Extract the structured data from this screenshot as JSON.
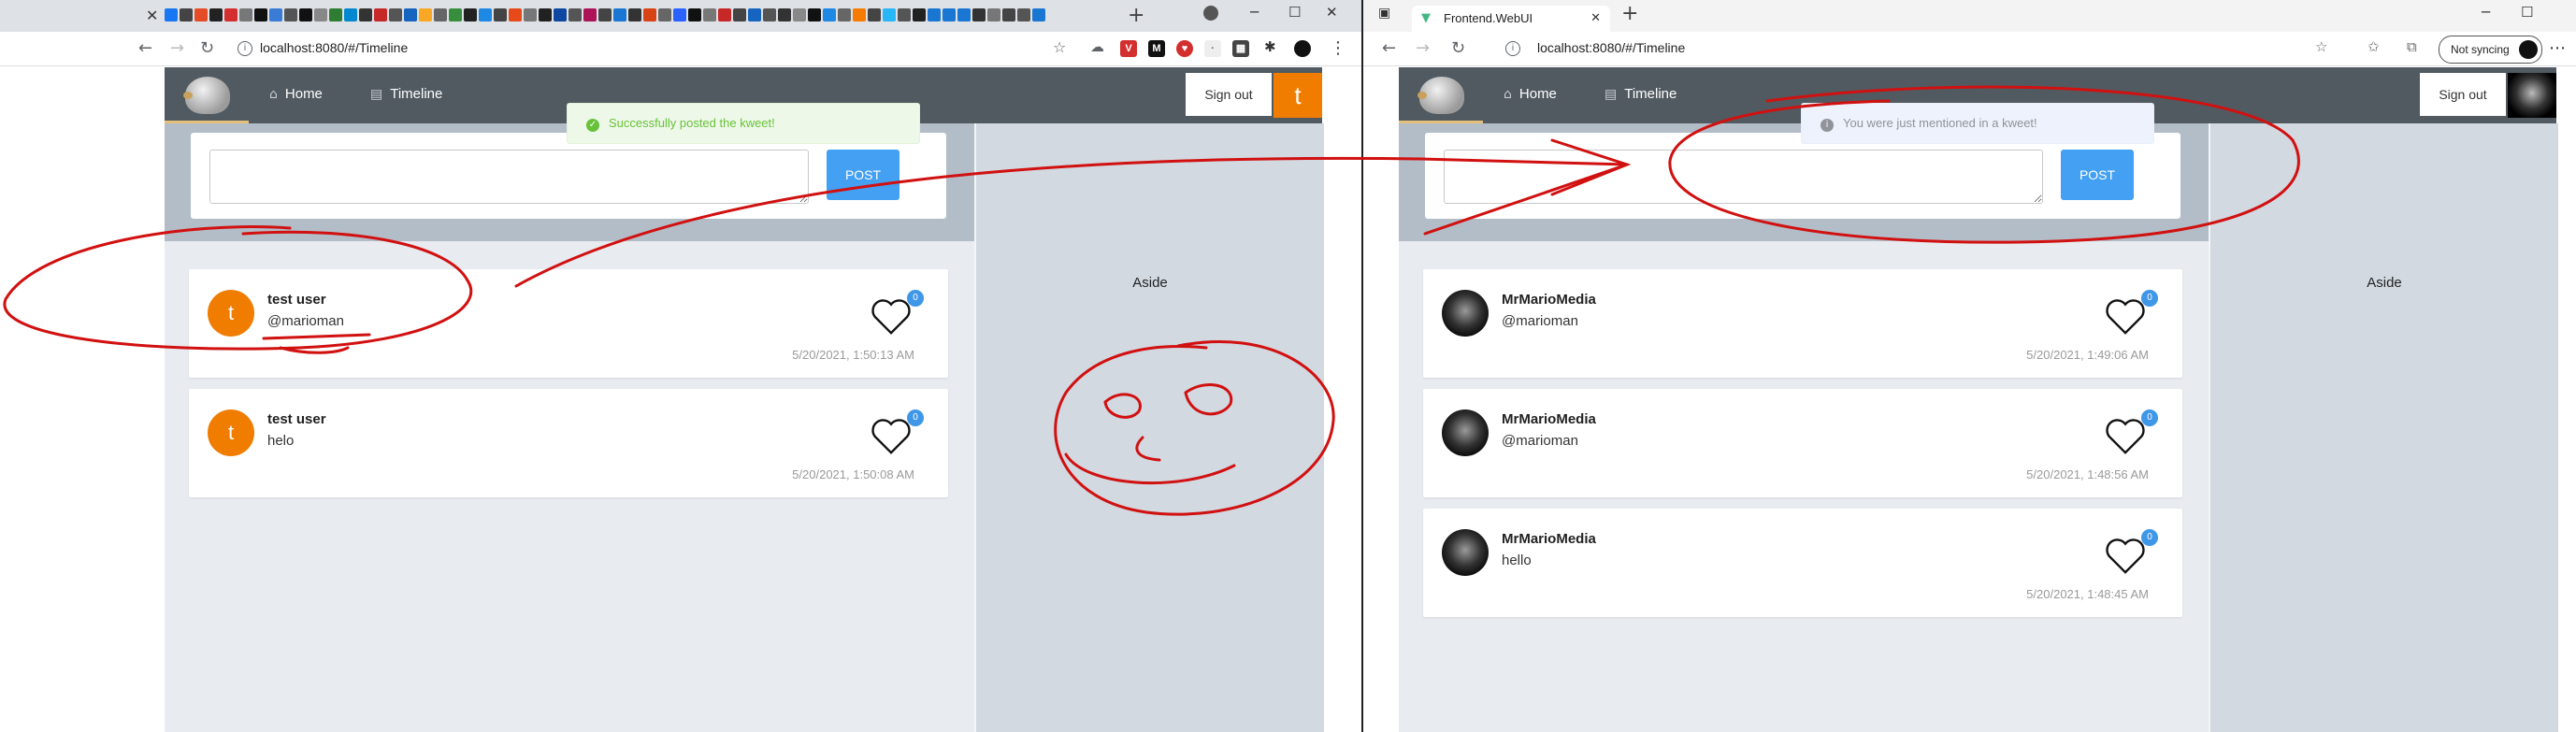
{
  "left": {
    "url": "localhost:8080/#/Timeline",
    "nav": {
      "home": "Home",
      "timeline": "Timeline",
      "signout": "Sign out",
      "avatar_letter": "t"
    },
    "composer": {
      "post": "POST"
    },
    "toast": "Successfully posted the kweet!",
    "aside": "Aside",
    "kweets": [
      {
        "name": "test user",
        "text": "@marioman",
        "likes": "0",
        "date": "5/20/2021, 1:50:13 AM",
        "avatar_letter": "t"
      },
      {
        "name": "test user",
        "text": "helo",
        "likes": "0",
        "date": "5/20/2021, 1:50:08 AM",
        "avatar_letter": "t"
      }
    ]
  },
  "right": {
    "tab_title": "Frontend.WebUI",
    "url": "localhost:8080/#/Timeline",
    "sync": "Not syncing",
    "nav": {
      "home": "Home",
      "timeline": "Timeline",
      "signout": "Sign out"
    },
    "composer": {
      "post": "POST"
    },
    "toast": "You were just mentioned in a kweet!",
    "aside": "Aside",
    "kweets": [
      {
        "name": "MrMarioMedia",
        "text": "@marioman",
        "likes": "0",
        "date": "5/20/2021, 1:49:06 AM"
      },
      {
        "name": "MrMarioMedia",
        "text": "@marioman",
        "likes": "0",
        "date": "5/20/2021, 1:48:56 AM"
      },
      {
        "name": "MrMarioMedia",
        "text": "hello",
        "likes": "0",
        "date": "5/20/2021, 1:48:45 AM"
      }
    ]
  },
  "colors": {
    "nav": "#515a61",
    "accent_orange": "#f07c00",
    "post_blue": "#43a0f2",
    "annotation_red": "#d11010"
  },
  "icons": {
    "home": "home-icon",
    "timeline": "document-icon",
    "like": "heart-icon",
    "back": "back-arrow-icon",
    "reload": "reload-icon"
  }
}
